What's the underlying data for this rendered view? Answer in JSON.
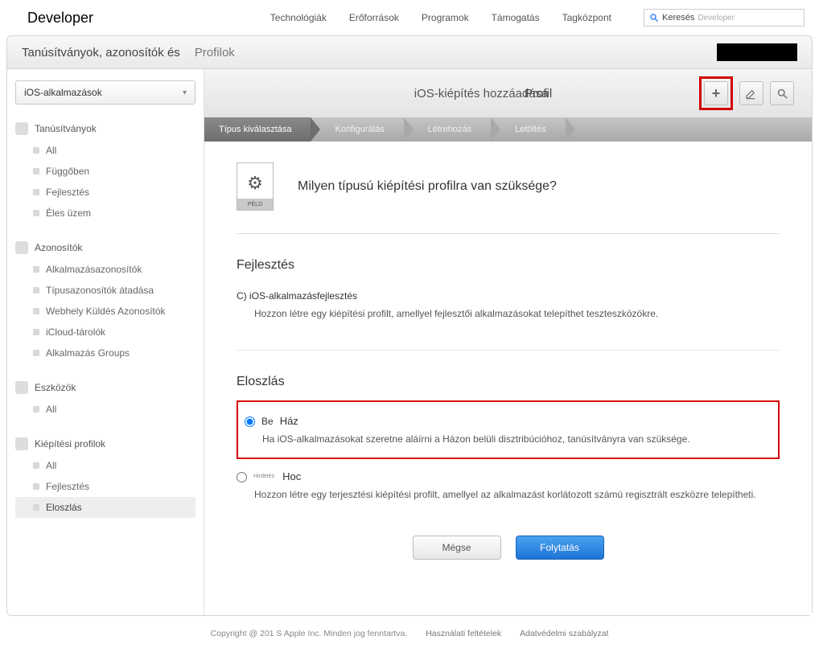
{
  "topnav": {
    "brand": "Developer",
    "links": [
      "Technológiák",
      "Erőforrások",
      "Programok",
      "Támogatás",
      "Tagközpont"
    ],
    "search_label": "Keresés",
    "search_scope": "Developer"
  },
  "titlebar": {
    "line1": "Tanúsítványok, azonosítók és",
    "line2": "Profilok"
  },
  "sidebar": {
    "dropdown": "iOS-alkalmazások",
    "sections": [
      {
        "header": "Tanúsítványok",
        "items": [
          "All",
          "Függőben",
          "Fejlesztés",
          "Éles üzem"
        ]
      },
      {
        "header": "Azonosítók",
        "items": [
          "Alkalmazásazonosítók",
          "Típusazonosítók átadása",
          "Webhely Küldés Azonosítók",
          "iCloud-tárolók",
          "Alkalmazás Groups"
        ]
      },
      {
        "header": "Eszközök",
        "items": [
          "All"
        ]
      },
      {
        "header": "Kiépítési profilok",
        "items": [
          "All",
          "Fejlesztés",
          "Eloszlás"
        ],
        "active_index": 2
      }
    ]
  },
  "mainhead": {
    "title": "iOS-kiépítés hozzáadása",
    "subtitle": "Profil"
  },
  "steps": [
    "Típus kiválasztása",
    "Konfigurálás",
    "Létrehozás",
    "Letöltés"
  ],
  "content": {
    "doc_badge": "PÉLD",
    "question": "Milyen típusú kiépítési profilra van szüksége?",
    "dev_section": "Fejlesztés",
    "dev_option_label": "C) iOS-alkalmazásfejlesztés",
    "dev_option_desc": "Hozzon létre egy kiépítési profilt, amellyel fejlesztői alkalmazásokat telepíthet teszteszközökre.",
    "dist_section": "Eloszlás",
    "inhouse_pre": "Be",
    "inhouse_label": "Ház",
    "inhouse_desc": "Ha iOS-alkalmazásokat szeretne aláírni a Házon belüli disztribúcióhoz, tanúsítványra van szüksége.",
    "adhoc_tiny": "Hirdetés",
    "adhoc_label": "Hoc",
    "adhoc_desc": "Hozzon létre egy terjesztési kiépítési profilt, amellyel az alkalmazást korlátozott számú regisztrált eszközre telepítheti."
  },
  "buttons": {
    "cancel": "Mégse",
    "continue": "Folytatás"
  },
  "footer": {
    "copyright": "Copyright @ 201 S Apple Inc. Minden jog fenntartva.",
    "terms": "Használati feltételek",
    "privacy": "Adatvédelmi szabályzat"
  }
}
